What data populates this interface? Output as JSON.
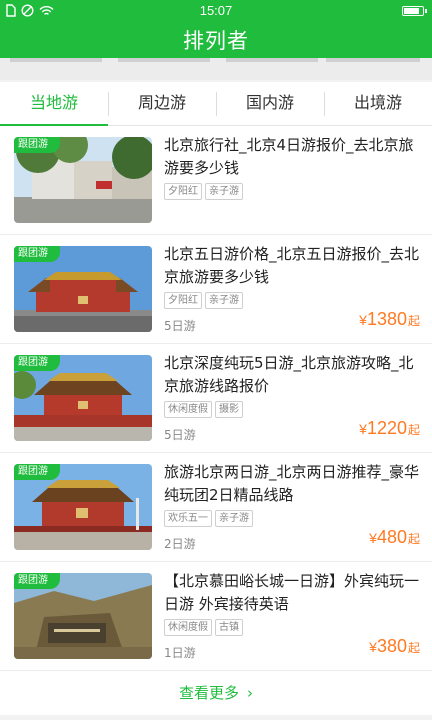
{
  "status_bar": {
    "time": "15:07",
    "icons": [
      "sim-icon",
      "dnd-icon",
      "wifi-icon",
      "battery-icon"
    ]
  },
  "header": {
    "title": "排列者"
  },
  "tabs": [
    {
      "label": "当地游",
      "active": true
    },
    {
      "label": "周边游",
      "active": false
    },
    {
      "label": "国内游",
      "active": false
    },
    {
      "label": "出境游",
      "active": false
    }
  ],
  "items": [
    {
      "tag": "跟团游",
      "title": "北京旅行社_北京4日游报价_去北京旅游要多少钱",
      "labels": [
        "夕阳红",
        "亲子游"
      ],
      "days": "",
      "price": {
        "currency": "",
        "value": "",
        "unit": ""
      }
    },
    {
      "tag": "跟团游",
      "title": "北京五日游价格_北京五日游报价_去北京旅游要多少钱",
      "labels": [
        "夕阳红",
        "亲子游"
      ],
      "days": "5日游",
      "price": {
        "currency": "¥",
        "value": "1380",
        "unit": "起"
      }
    },
    {
      "tag": "跟团游",
      "title": "北京深度纯玩5日游_北京旅游攻略_北京旅游线路报价",
      "labels": [
        "休闲度假",
        "摄影"
      ],
      "days": "5日游",
      "price": {
        "currency": "¥",
        "value": "1220",
        "unit": "起"
      }
    },
    {
      "tag": "跟团游",
      "title": "旅游北京两日游_北京两日游推荐_豪华纯玩团2日精品线路",
      "labels": [
        "欢乐五一",
        "亲子游"
      ],
      "days": "2日游",
      "price": {
        "currency": "¥",
        "value": "480",
        "unit": "起"
      }
    },
    {
      "tag": "跟团游",
      "title": "【北京慕田峪长城一日游】外宾纯玩一日游 外宾接待英语",
      "labels": [
        "休闲度假",
        "古镇"
      ],
      "days": "1日游",
      "price": {
        "currency": "¥",
        "value": "380",
        "unit": "起"
      }
    }
  ],
  "footer": {
    "more_label": "查看更多",
    "more_icon": "chevron-right-icon"
  },
  "colors": {
    "brand": "#1fbc3d",
    "price": "#ff7a22"
  }
}
